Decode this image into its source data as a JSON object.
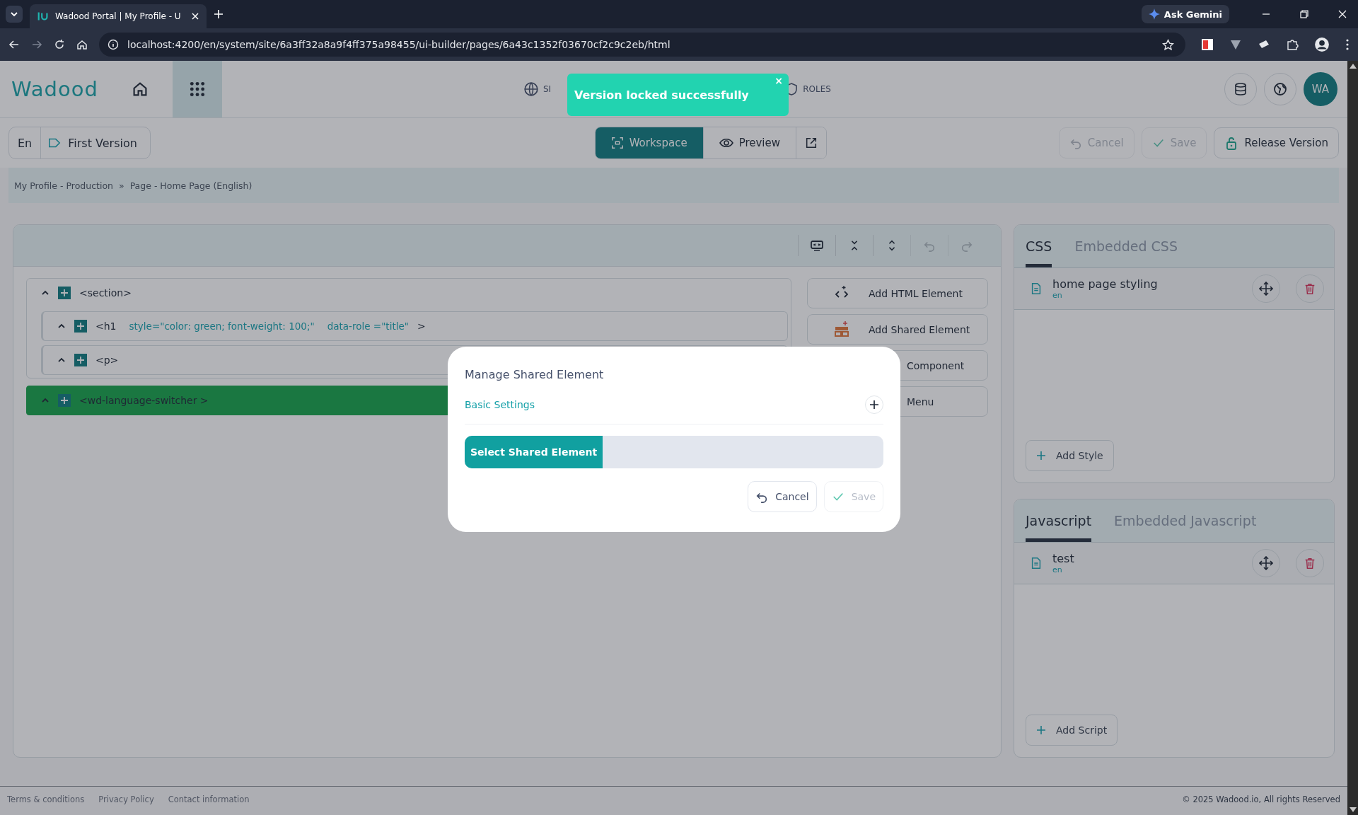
{
  "browser": {
    "tab_title": "Wadood Portal | My Profile - U",
    "url": "localhost:4200/en/system/site/6a3ff32a8a9f4ff375a98455/ui-builder/pages/6a43c1352f03670cf2c9c2eb/html",
    "gemini": "Ask Gemini"
  },
  "header": {
    "logo": "Wadood",
    "nav": [
      {
        "label": "SI",
        "kind": "globe"
      },
      {
        "label": "ROLES",
        "kind": "shield"
      }
    ],
    "avatar": "WA"
  },
  "toast": {
    "message": "Version locked successfully",
    "close": "×"
  },
  "toolbar": {
    "language": "En",
    "version": "First Version",
    "views": [
      {
        "label": "Workspace",
        "selected": true
      },
      {
        "label": "Preview",
        "selected": false
      }
    ],
    "actions": [
      {
        "label": "Cancel",
        "kind": "cancel",
        "disabled": true
      },
      {
        "label": "Save",
        "kind": "save",
        "disabled": true
      },
      {
        "label": "Release Version",
        "kind": "release",
        "disabled": false
      }
    ]
  },
  "breadcrumb": {
    "items": [
      "My Profile - Production",
      "Page - Home Page (English)"
    ],
    "separator": "»"
  },
  "workspace": {
    "tools": [
      {
        "kind": "screen",
        "disabled": false
      },
      {
        "kind": "collapse",
        "disabled": false
      },
      {
        "kind": "expand",
        "disabled": false
      },
      {
        "kind": "undo",
        "disabled": true
      },
      {
        "kind": "redo",
        "disabled": true
      }
    ],
    "tree": [
      {
        "label": "<section>",
        "expanded": true,
        "selected": false,
        "children": [
          {
            "label": "<h1",
            "attributes": [
              "style=\"color: green; font-weight: 100;\"",
              "data-role =\"title\""
            ],
            "end": ">",
            "expanded": true,
            "selected": false
          },
          {
            "label": "<p>",
            "expanded": true,
            "selected": false
          }
        ]
      },
      {
        "label": "<wd-language-switcher >",
        "expanded": true,
        "selected": true
      }
    ],
    "add_buttons": [
      {
        "label": "Add HTML Element",
        "kind": "html"
      },
      {
        "label": "Add Shared Element",
        "kind": "shared"
      },
      {
        "label": "Component",
        "kind": "hidden"
      },
      {
        "label": "Menu",
        "kind": "hidden"
      }
    ]
  },
  "styles": {
    "tabs": [
      {
        "label": "CSS",
        "selected": true
      },
      {
        "label": "Embedded CSS",
        "selected": false
      }
    ],
    "items": [
      {
        "name": "home page styling",
        "lang": "en"
      }
    ],
    "add": "Add Style"
  },
  "scripts": {
    "tabs": [
      {
        "label": "Javascript",
        "selected": true
      },
      {
        "label": "Embedded Javascript",
        "selected": false
      }
    ],
    "items": [
      {
        "name": "test",
        "lang": "en"
      }
    ],
    "add": "Add Script"
  },
  "modal": {
    "title": "Manage Shared Element",
    "section": "Basic Settings",
    "select_label": "Select Shared Element",
    "buttons": [
      {
        "label": "Cancel",
        "kind": "cancel",
        "disabled": false
      },
      {
        "label": "Save",
        "kind": "save",
        "disabled": true
      }
    ]
  },
  "footer": {
    "links": [
      "Terms & conditions",
      "Privacy Policy",
      "Contact information"
    ],
    "copyright": "© 2025 Wadood.io, All rights Reserved"
  }
}
